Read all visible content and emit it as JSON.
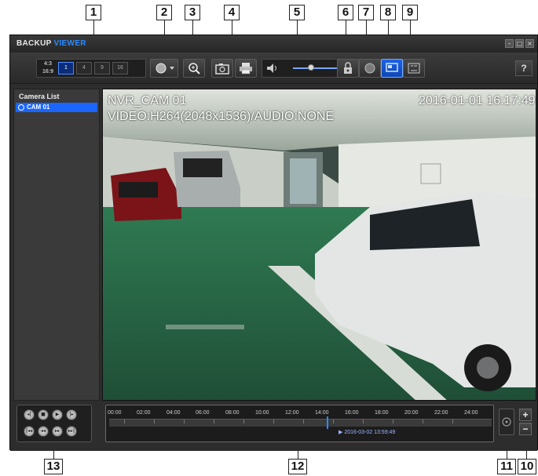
{
  "callouts": [
    "1",
    "2",
    "3",
    "4",
    "5",
    "6",
    "7",
    "8",
    "9",
    "10",
    "11",
    "12",
    "13"
  ],
  "app": {
    "title_main": "BACKUP",
    "title_accent": "VIEWER",
    "help_label": "?"
  },
  "toolbar": {
    "aspect_ratios": [
      "4:3",
      "16:9"
    ],
    "split_options": [
      "1",
      "4",
      "9",
      "16"
    ],
    "active_split": "1"
  },
  "sidebar": {
    "title": "Camera List",
    "cameras": [
      "CAM 01"
    ]
  },
  "video": {
    "camera_name": "NVR_CAM 01",
    "datetime": "2016-01-01  16:17:49",
    "stream_info": "VIDEO:H264(2048x1536)/AUDIO:NONE"
  },
  "timeline": {
    "hours": [
      "00:00",
      "02:00",
      "04:00",
      "06:00",
      "08:00",
      "10:00",
      "12:00",
      "14:00",
      "16:00",
      "18:00",
      "20:00",
      "22:00",
      "24:00"
    ],
    "timestamp": "▶ 2016-03-02 13:59:49"
  },
  "colors": {
    "accent": "#1a66ff",
    "background": "#2d2d2d"
  }
}
